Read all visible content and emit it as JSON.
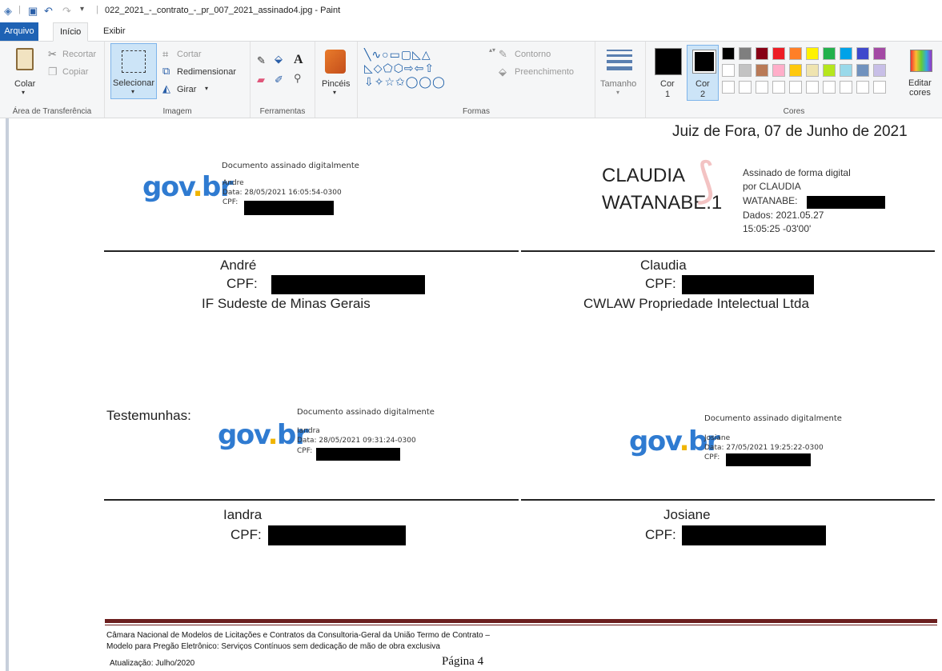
{
  "window": {
    "title": "022_2021_-_contrato_-_pr_007_2021_assinado4.jpg - Paint"
  },
  "tabs": {
    "arquivo": "Arquivo",
    "inicio": "Início",
    "exibir": "Exibir"
  },
  "ribbon": {
    "clipboard": {
      "paste": "Colar",
      "cut": "Recortar",
      "copy": "Copiar",
      "caption": "Área de Transferência"
    },
    "image": {
      "select": "Selecionar",
      "crop": "Cortar",
      "resize": "Redimensionar",
      "rotate": "Girar",
      "caption": "Imagem"
    },
    "tools": {
      "caption": "Ferramentas"
    },
    "brushes": {
      "label": "Pincéis"
    },
    "shapes": {
      "outline": "Contorno",
      "fill": "Preenchimento",
      "caption": "Formas"
    },
    "size": {
      "label": "Tamanho"
    },
    "colors": {
      "color1": "Cor",
      "color1_num": "1",
      "color2": "Cor",
      "color2_num": "2",
      "edit": "Editar",
      "edit2": "cores",
      "caption": "Cores",
      "palette_row1": [
        "#000000",
        "#7f7f7f",
        "#880015",
        "#ed1c24",
        "#ff7f27",
        "#fff200",
        "#22b14c",
        "#00a2e8",
        "#3f48cc",
        "#a349a4"
      ],
      "palette_row2": [
        "#ffffff",
        "#c3c3c3",
        "#b97a57",
        "#ffaec9",
        "#ffc90e",
        "#efe4b0",
        "#b5e61d",
        "#99d9ea",
        "#7092be",
        "#c8bfe7"
      ]
    }
  },
  "document": {
    "place_date": "Juiz de Fora, 07 de Junho de 2021",
    "sig_andre": {
      "header": "Documento assinado digitalmente",
      "name": "Andre",
      "date": "Data: 28/05/2021 16:05:54-0300",
      "cpf": "CPF:"
    },
    "sig_claudia": {
      "big1": "CLAUDIA",
      "big2": "WATANABE:1",
      "line1": "Assinado de forma digital",
      "line2": "por CLAUDIA",
      "line3": "WATANABE:",
      "line4": "Dados: 2021.05.27",
      "line5": "15:05:25 -03'00'"
    },
    "party1": {
      "name": "André",
      "cpf": "CPF:",
      "org": "IF Sudeste de Minas Gerais"
    },
    "party2": {
      "name": "Claudia",
      "cpf": "CPF:",
      "org": "CWLAW Propriedade Intelectual Ltda"
    },
    "witnesses_label": "Testemunhas:",
    "sig_iandra": {
      "header": "Documento assinado digitalmente",
      "name": "Iandra",
      "date": "Data: 28/05/2021 09:31:24-0300",
      "cpf": "CPF:"
    },
    "sig_josiane": {
      "header": "Documento assinado digitalmente",
      "name": "Josiane",
      "date": "Data: 27/05/2021 19:25:22-0300",
      "cpf": "CPF:"
    },
    "witness1": {
      "name": "Iandra",
      "cpf": "CPF:"
    },
    "witness2": {
      "name": "Josiane",
      "cpf": "CPF:"
    },
    "govbr": {
      "g1": "gov",
      "g2": ".",
      "g3": "br"
    },
    "footer": {
      "line1": "Câmara Nacional de Modelos de Licitações e Contratos da Consultoria-Geral da União Termo de Contrato –",
      "line2": "Modelo para Pregão Eletrônico: Serviços Contínuos sem dedicação de mão de obra exclusiva",
      "update": "Atualização: Julho/2020",
      "page": "Página 4"
    }
  }
}
